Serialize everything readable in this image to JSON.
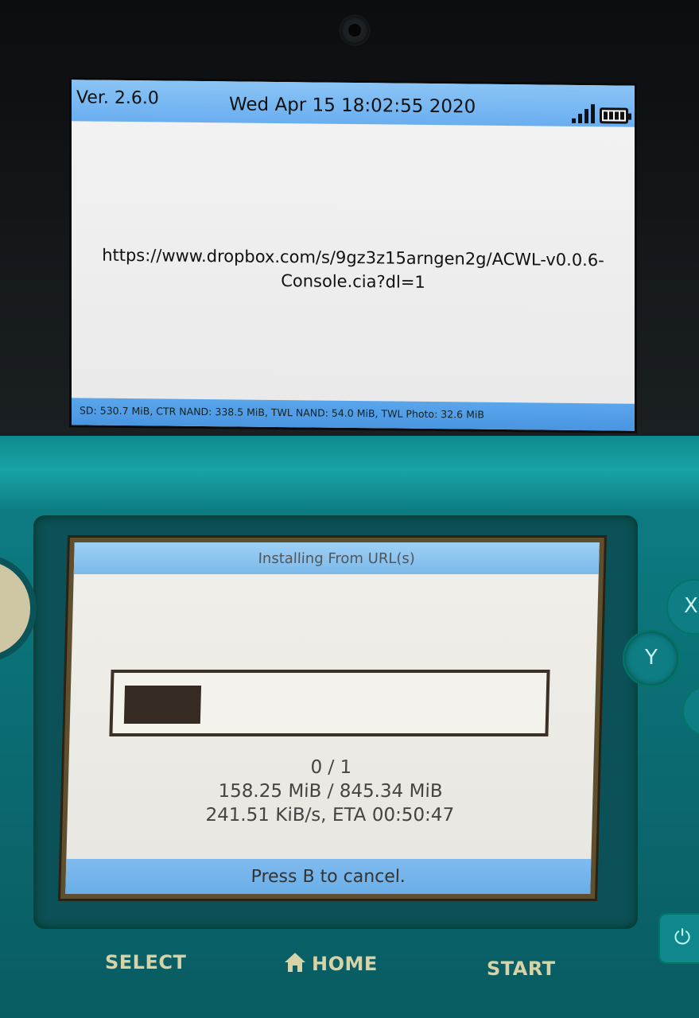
{
  "top_screen": {
    "version": "Ver. 2.6.0",
    "datetime": "Wed Apr 15 18:02:55 2020",
    "url_line1": "https://www.dropbox.com/s/9gz3z15arngen2g/ACWL-v0.0.6-",
    "url_line2": "Console.cia?dl=1",
    "storage_info": "SD: 530.7 MiB, CTR NAND: 338.5 MiB, TWL NAND: 54.0 MiB, TWL Photo: 32.6 MiB",
    "icons": [
      "wifi-signal-icon",
      "battery-icon"
    ]
  },
  "bottom_screen": {
    "title": "Installing From URL(s)",
    "progress_fraction": 0.187,
    "file_count": "0 / 1",
    "size_progress": "158.25 MiB / 845.34 MiB",
    "speed_eta": "241.51 KiB/s, ETA 00:50:47",
    "footer": "Press B to cancel."
  },
  "hardware": {
    "select_label": "SELECT",
    "home_label": "HOME",
    "start_label": "START",
    "y_label": "Y",
    "x_label": "X"
  }
}
